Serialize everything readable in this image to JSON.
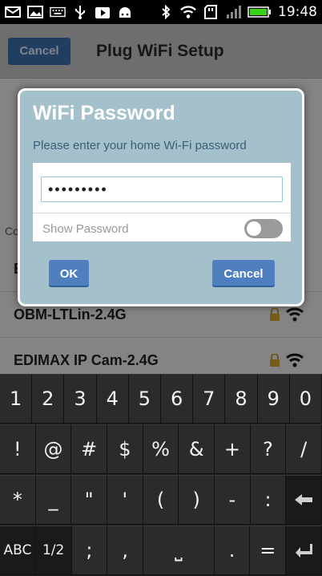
{
  "status_bar": {
    "time": "19:48",
    "left_icons": [
      "mail-icon",
      "photo-icon",
      "keyboard-icon",
      "usb-icon",
      "play-store-icon",
      "android-icon"
    ],
    "right_icons": [
      "bluetooth-icon",
      "wifi-icon",
      "sd-card-icon",
      "signal-icon",
      "battery-icon"
    ]
  },
  "app": {
    "header": {
      "cancel_label": "Cancel",
      "title": "Plug WiFi Setup"
    },
    "section_label": "Co",
    "networks": [
      {
        "ssid": "E"
      },
      {
        "ssid": "OBM-LTLin-2.4G"
      },
      {
        "ssid": "EDIMAX IP Cam-2.4G"
      }
    ]
  },
  "dialog": {
    "title": "WiFi Password",
    "prompt": "Please enter your home Wi-Fi password",
    "password_value": "•••••••••",
    "show_password_label": "Show Password",
    "show_password_on": false,
    "ok_label": "OK",
    "cancel_label": "Cancel"
  },
  "keyboard": {
    "row1": [
      "1",
      "2",
      "3",
      "4",
      "5",
      "6",
      "7",
      "8",
      "9",
      "0"
    ],
    "row2": [
      "!",
      "@",
      "#",
      "$",
      "%",
      "&",
      "+",
      "?",
      "/"
    ],
    "row3": [
      "*",
      "_",
      "\"",
      "'",
      "(",
      ")",
      "-",
      ":"
    ],
    "row4": {
      "abc": "ABC",
      "page": "1/2",
      "semicolon": ";",
      "comma": ",",
      "space": "⎵",
      "period": ".",
      "equals": "="
    }
  },
  "colors": {
    "dialog_bg": "#a3c0cb",
    "button_blue": "#4f7fbf",
    "key_bg": "#2b2b2b"
  }
}
